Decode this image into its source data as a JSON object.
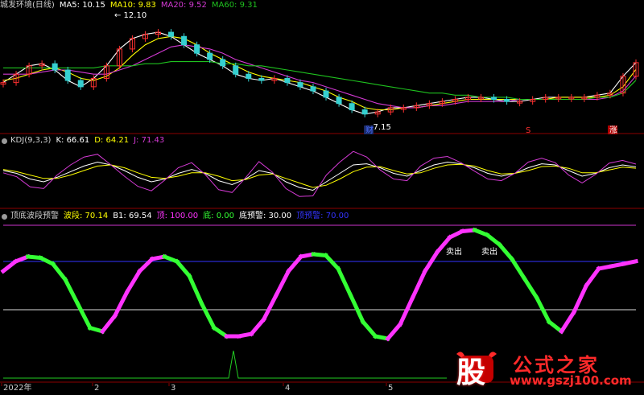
{
  "colors": {
    "bg": "#000000",
    "divider": "#8b0000",
    "up": "#ff3030",
    "down": "#35d0d0",
    "ma5": "#ffffff",
    "ma10": "#ffff00",
    "ma20": "#d43ad4",
    "ma60": "#1fc21f",
    "k": "#ffffff",
    "d": "#ffff00",
    "j": "#d43ad4",
    "bottom_up": "#ff33ff",
    "bottom_down": "#33ff33",
    "ref_blue": "#3333ff",
    "ref_white": "#dddddd",
    "top_line": "#cc33cc",
    "spike_green": "#22cc22"
  },
  "price_panel": {
    "title": "城发环境(日线)",
    "ma_labels": [
      {
        "text": "MA5: 10.15",
        "color": "#ffffff"
      },
      {
        "text": "MA10: 9.83",
        "color": "#ffff00"
      },
      {
        "text": "MA20: 9.52",
        "color": "#d43ad4"
      },
      {
        "text": "MA60: 9.31",
        "color": "#1fc21f"
      }
    ],
    "high_label": "12.10",
    "low_label": "7.15",
    "markers": [
      {
        "text": "财",
        "color": "#4a6cff"
      },
      {
        "text": "S",
        "color": "#ff3030"
      },
      {
        "text": "涨",
        "color": "#ffffff"
      }
    ]
  },
  "kdj_panel": {
    "labels": [
      {
        "text": "KDJ(9,3,3)",
        "color": "#cfcfcf"
      },
      {
        "text": "K: 66.61",
        "color": "#ffffff"
      },
      {
        "text": "D: 64.21",
        "color": "#ffff00"
      },
      {
        "text": "J: 71.43",
        "color": "#d43ad4"
      }
    ]
  },
  "bottom_panel": {
    "labels": [
      {
        "text": "顶底波段预警",
        "color": "#cfcfcf"
      },
      {
        "text": "波段: 70.14",
        "color": "#ffff00"
      },
      {
        "text": "B1: 69.54",
        "color": "#ffffff"
      },
      {
        "text": "顶: 100.00",
        "color": "#ff33ff"
      },
      {
        "text": "底: 0.00",
        "color": "#33ff33"
      },
      {
        "text": "底预警: 30.00",
        "color": "#ffffff"
      },
      {
        "text": "顶预警: 70.00",
        "color": "#3333ff"
      }
    ],
    "sell_labels": [
      "卖出",
      "卖出"
    ]
  },
  "x_axis": {
    "labels": [
      "2022年",
      "2",
      "3",
      "4",
      "5"
    ]
  },
  "watermark": {
    "logo_char": "股",
    "name": "公式之家",
    "url": "www.gszj100.com"
  },
  "chart_data": [
    {
      "type": "line",
      "title": "城发环境(日线)",
      "series": [
        {
          "name": "MA5",
          "values": [
            9.2,
            9.6,
            10.0,
            10.1,
            9.8,
            9.3,
            9.0,
            9.4,
            10.0,
            10.8,
            11.3,
            11.5,
            11.6,
            11.4,
            11.0,
            10.6,
            10.3,
            10.0,
            9.6,
            9.4,
            9.3,
            9.4,
            9.2,
            9.0,
            8.8,
            8.5,
            8.2,
            7.9,
            7.7,
            7.8,
            8.0,
            8.0,
            8.1,
            8.2,
            8.3,
            8.4,
            8.5,
            8.5,
            8.4,
            8.3,
            8.3,
            8.4,
            8.5,
            8.5,
            8.5,
            8.5,
            8.6,
            8.7,
            9.5,
            10.15
          ]
        },
        {
          "name": "MA10",
          "values": [
            9.3,
            9.4,
            9.6,
            9.8,
            9.9,
            9.7,
            9.4,
            9.3,
            9.5,
            9.9,
            10.5,
            11.0,
            11.3,
            11.4,
            11.3,
            11.0,
            10.6,
            10.3,
            10.0,
            9.7,
            9.5,
            9.4,
            9.3,
            9.2,
            9.0,
            8.8,
            8.5,
            8.3,
            8.0,
            7.9,
            7.9,
            8.0,
            8.0,
            8.1,
            8.2,
            8.3,
            8.4,
            8.4,
            8.4,
            8.4,
            8.4,
            8.4,
            8.4,
            8.5,
            8.5,
            8.5,
            8.5,
            8.6,
            9.0,
            9.83
          ]
        },
        {
          "name": "MA20",
          "values": [
            9.6,
            9.6,
            9.6,
            9.7,
            9.8,
            9.8,
            9.7,
            9.6,
            9.6,
            9.8,
            10.0,
            10.3,
            10.6,
            10.9,
            11.0,
            10.9,
            10.8,
            10.6,
            10.3,
            10.1,
            9.9,
            9.7,
            9.5,
            9.3,
            9.2,
            9.0,
            8.8,
            8.6,
            8.4,
            8.2,
            8.1,
            8.0,
            8.0,
            8.1,
            8.1,
            8.2,
            8.3,
            8.3,
            8.3,
            8.3,
            8.4,
            8.4,
            8.4,
            8.4,
            8.4,
            8.4,
            8.4,
            8.5,
            8.8,
            9.52
          ]
        },
        {
          "name": "MA60",
          "values": [
            9.9,
            9.9,
            9.9,
            9.9,
            9.9,
            9.9,
            9.9,
            9.9,
            10.0,
            10.0,
            10.0,
            10.1,
            10.1,
            10.2,
            10.2,
            10.2,
            10.2,
            10.1,
            10.1,
            10.0,
            10.0,
            9.9,
            9.8,
            9.7,
            9.6,
            9.5,
            9.4,
            9.3,
            9.2,
            9.1,
            9.0,
            8.9,
            8.8,
            8.7,
            8.7,
            8.6,
            8.6,
            8.5,
            8.5,
            8.5,
            8.4,
            8.4,
            8.4,
            8.4,
            8.4,
            8.4,
            8.5,
            8.5,
            8.7,
            9.31
          ]
        }
      ],
      "ylim": [
        7.0,
        12.6
      ]
    },
    {
      "type": "line",
      "title": "KDJ(9,3,3)",
      "series": [
        {
          "name": "K",
          "values": [
            60,
            55,
            45,
            40,
            48,
            58,
            68,
            75,
            70,
            60,
            48,
            40,
            45,
            55,
            62,
            55,
            42,
            35,
            45,
            60,
            55,
            40,
            30,
            25,
            40,
            55,
            70,
            72,
            65,
            55,
            50,
            60,
            70,
            75,
            72,
            65,
            55,
            50,
            55,
            65,
            72,
            70,
            60,
            50,
            55,
            65,
            70,
            66.61
          ]
        },
        {
          "name": "D",
          "values": [
            62,
            58,
            52,
            46,
            46,
            52,
            60,
            68,
            70,
            65,
            56,
            48,
            46,
            50,
            56,
            56,
            50,
            42,
            44,
            52,
            54,
            46,
            38,
            30,
            34,
            45,
            58,
            66,
            67,
            60,
            54,
            56,
            64,
            70,
            71,
            68,
            60,
            54,
            55,
            60,
            67,
            68,
            64,
            56,
            56,
            61,
            66,
            64.21
          ]
        },
        {
          "name": "J",
          "values": [
            56,
            49,
            31,
            28,
            52,
            70,
            84,
            89,
            70,
            50,
            32,
            24,
            43,
            65,
            74,
            53,
            26,
            21,
            47,
            76,
            57,
            28,
            14,
            15,
            52,
            75,
            94,
            84,
            61,
            45,
            42,
            68,
            82,
            85,
            74,
            59,
            45,
            42,
            55,
            75,
            82,
            74,
            52,
            38,
            53,
            73,
            78,
            71.43
          ]
        }
      ],
      "ylim": [
        0,
        100
      ]
    },
    {
      "type": "line",
      "title": "顶底波段预警",
      "series": [
        {
          "name": "波段",
          "values": [
            62,
            70,
            74,
            73,
            68,
            55,
            35,
            15,
            12,
            25,
            45,
            62,
            72,
            74,
            70,
            58,
            35,
            15,
            8,
            8,
            10,
            22,
            42,
            62,
            74,
            76,
            75,
            64,
            42,
            20,
            8,
            6,
            18,
            40,
            62,
            78,
            90,
            95,
            96,
            92,
            84,
            72,
            56,
            40,
            20,
            12,
            28,
            50,
            64,
            66,
            68,
            70.14
          ]
        },
        {
          "name": "顶",
          "values": [
            100,
            100,
            100,
            100,
            100,
            100,
            100,
            100,
            100,
            100,
            100,
            100,
            100,
            100,
            100,
            100,
            100,
            100,
            100,
            100,
            100,
            100,
            100,
            100,
            100,
            100,
            100,
            100,
            100,
            100,
            100,
            100,
            100,
            100,
            100,
            100,
            100,
            100,
            100,
            100,
            100,
            100,
            100,
            100,
            100,
            100,
            100,
            100,
            100,
            100,
            100,
            100
          ]
        },
        {
          "name": "底预警",
          "values": [
            30,
            30,
            30,
            30,
            30,
            30,
            30,
            30,
            30,
            30,
            30,
            30,
            30,
            30,
            30,
            30,
            30,
            30,
            30,
            30,
            30,
            30,
            30,
            30,
            30,
            30,
            30,
            30,
            30,
            30,
            30,
            30,
            30,
            30,
            30,
            30,
            30,
            30,
            30,
            30,
            30,
            30,
            30,
            30,
            30,
            30,
            30,
            30,
            30,
            30,
            30,
            30
          ]
        },
        {
          "name": "顶预警",
          "values": [
            70,
            70,
            70,
            70,
            70,
            70,
            70,
            70,
            70,
            70,
            70,
            70,
            70,
            70,
            70,
            70,
            70,
            70,
            70,
            70,
            70,
            70,
            70,
            70,
            70,
            70,
            70,
            70,
            70,
            70,
            70,
            70,
            70,
            70,
            70,
            70,
            70,
            70,
            70,
            70,
            70,
            70,
            70,
            70,
            70,
            70,
            70,
            70,
            70,
            70,
            70,
            70
          ]
        }
      ],
      "ylim": [
        0,
        100
      ]
    }
  ]
}
